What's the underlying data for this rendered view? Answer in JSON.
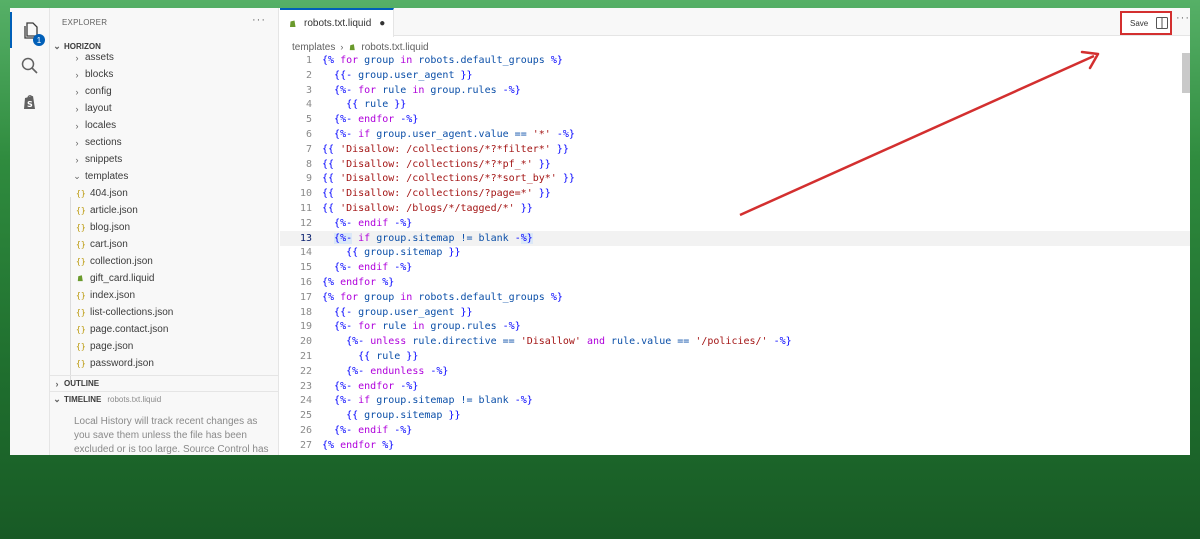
{
  "activity": {
    "explorer_badge": "1"
  },
  "sidebar": {
    "title": "EXPLORER",
    "more": "···",
    "project": "HORIZON",
    "folders": [
      "assets",
      "blocks",
      "config",
      "layout",
      "locales",
      "sections",
      "snippets"
    ],
    "templates_folder": "templates",
    "template_files": [
      {
        "name": "404.json",
        "icon": "{}"
      },
      {
        "name": "article.json",
        "icon": "{}"
      },
      {
        "name": "blog.json",
        "icon": "{}"
      },
      {
        "name": "cart.json",
        "icon": "{}"
      },
      {
        "name": "collection.json",
        "icon": "{}"
      },
      {
        "name": "gift_card.liquid",
        "icon": "shopify-icon"
      },
      {
        "name": "index.json",
        "icon": "{}"
      },
      {
        "name": "list-collections.json",
        "icon": "{}"
      },
      {
        "name": "page.contact.json",
        "icon": "{}"
      },
      {
        "name": "page.json",
        "icon": "{}"
      },
      {
        "name": "password.json",
        "icon": "{}"
      }
    ],
    "outline_label": "OUTLINE",
    "timeline_label": "TIMELINE",
    "timeline_file": "robots.txt.liquid",
    "timeline_text": "Local History will track recent changes as you save them unless the file has been excluded or is too large. Source Control has"
  },
  "editor": {
    "tab_label": "robots.txt.liquid",
    "tab_dirty": "●",
    "save_label": "Save",
    "more": "···",
    "breadcrumb": [
      "templates",
      "robots.txt.liquid"
    ],
    "current_line": 13
  },
  "code_lines": [
    [
      {
        "t": "{% ",
        "c": "kw-c"
      },
      {
        "t": "for",
        "c": "kw-m"
      },
      {
        "t": " group ",
        "c": "vr"
      },
      {
        "t": "in",
        "c": "kw-m"
      },
      {
        "t": " robots.default_groups ",
        "c": "vr"
      },
      {
        "t": "%}",
        "c": "kw-c"
      }
    ],
    [
      {
        "t": "  "
      },
      {
        "t": "{{- ",
        "c": "kw-c"
      },
      {
        "t": "group.user_agent",
        "c": "vr"
      },
      {
        "t": " }}",
        "c": "kw-c"
      }
    ],
    [
      {
        "t": "  "
      },
      {
        "t": "{%- ",
        "c": "kw-c"
      },
      {
        "t": "for",
        "c": "kw-m"
      },
      {
        "t": " rule ",
        "c": "vr"
      },
      {
        "t": "in",
        "c": "kw-m"
      },
      {
        "t": " group.rules ",
        "c": "vr"
      },
      {
        "t": "-%}",
        "c": "kw-c"
      }
    ],
    [
      {
        "t": "    "
      },
      {
        "t": "{{ ",
        "c": "kw-c"
      },
      {
        "t": "rule",
        "c": "vr"
      },
      {
        "t": " }}",
        "c": "kw-c"
      }
    ],
    [
      {
        "t": "  "
      },
      {
        "t": "{%- ",
        "c": "kw-c"
      },
      {
        "t": "endfor",
        "c": "kw-m"
      },
      {
        "t": " -%}",
        "c": "kw-c"
      }
    ],
    [
      {
        "t": "  "
      },
      {
        "t": "{%- ",
        "c": "kw-c"
      },
      {
        "t": "if",
        "c": "kw-m"
      },
      {
        "t": " group.user_agent.value == ",
        "c": "vr"
      },
      {
        "t": "'*'",
        "c": "st"
      },
      {
        "t": " -%}",
        "c": "kw-c"
      }
    ],
    [
      {
        "t": "{{ ",
        "c": "kw-c"
      },
      {
        "t": "'Disallow: /collections/*?*filter*'",
        "c": "st"
      },
      {
        "t": " }}",
        "c": "kw-c"
      }
    ],
    [
      {
        "t": "{{ ",
        "c": "kw-c"
      },
      {
        "t": "'Disallow: /collections/*?*pf_*'",
        "c": "st"
      },
      {
        "t": " }}",
        "c": "kw-c"
      }
    ],
    [
      {
        "t": "{{ ",
        "c": "kw-c"
      },
      {
        "t": "'Disallow: /collections/*?*sort_by*'",
        "c": "st"
      },
      {
        "t": " }}",
        "c": "kw-c"
      }
    ],
    [
      {
        "t": "{{ ",
        "c": "kw-c"
      },
      {
        "t": "'Disallow: /collections/?page=*'",
        "c": "st"
      },
      {
        "t": " }}",
        "c": "kw-c"
      }
    ],
    [
      {
        "t": "{{ ",
        "c": "kw-c"
      },
      {
        "t": "'Disallow: /blogs/*/tagged/*'",
        "c": "st"
      },
      {
        "t": " }}",
        "c": "kw-c"
      }
    ],
    [
      {
        "t": "  "
      },
      {
        "t": "{%- ",
        "c": "kw-c"
      },
      {
        "t": "endif",
        "c": "kw-m"
      },
      {
        "t": " -%}",
        "c": "kw-c"
      }
    ],
    [
      {
        "t": "  "
      },
      {
        "t": "{%-",
        "c": "kw-c hl"
      },
      {
        "t": " "
      },
      {
        "t": "if",
        "c": "kw-m"
      },
      {
        "t": " group.sitemap != blank ",
        "c": "vr"
      },
      {
        "t": "-",
        "c": "kw-c"
      },
      {
        "t": "%}",
        "c": "kw-c hl"
      }
    ],
    [
      {
        "t": "    "
      },
      {
        "t": "{{ ",
        "c": "kw-c"
      },
      {
        "t": "group.sitemap",
        "c": "vr"
      },
      {
        "t": " }}",
        "c": "kw-c"
      }
    ],
    [
      {
        "t": "  "
      },
      {
        "t": "{%- ",
        "c": "kw-c"
      },
      {
        "t": "endif",
        "c": "kw-m"
      },
      {
        "t": " -%}",
        "c": "kw-c"
      }
    ],
    [
      {
        "t": "{% ",
        "c": "kw-c"
      },
      {
        "t": "endfor",
        "c": "kw-m"
      },
      {
        "t": " %}",
        "c": "kw-c"
      }
    ],
    [
      {
        "t": "{% ",
        "c": "kw-c"
      },
      {
        "t": "for",
        "c": "kw-m"
      },
      {
        "t": " group ",
        "c": "vr"
      },
      {
        "t": "in",
        "c": "kw-m"
      },
      {
        "t": " robots.default_groups ",
        "c": "vr"
      },
      {
        "t": "%}",
        "c": "kw-c"
      }
    ],
    [
      {
        "t": "  "
      },
      {
        "t": "{{- ",
        "c": "kw-c"
      },
      {
        "t": "group.user_agent",
        "c": "vr"
      },
      {
        "t": " }}",
        "c": "kw-c"
      }
    ],
    [
      {
        "t": "  "
      },
      {
        "t": "{%- ",
        "c": "kw-c"
      },
      {
        "t": "for",
        "c": "kw-m"
      },
      {
        "t": " rule ",
        "c": "vr"
      },
      {
        "t": "in",
        "c": "kw-m"
      },
      {
        "t": " group.rules ",
        "c": "vr"
      },
      {
        "t": "-%}",
        "c": "kw-c"
      }
    ],
    [
      {
        "t": "    "
      },
      {
        "t": "{%- ",
        "c": "kw-c"
      },
      {
        "t": "unless",
        "c": "kw-m"
      },
      {
        "t": " rule.directive == ",
        "c": "vr"
      },
      {
        "t": "'Disallow'",
        "c": "st"
      },
      {
        "t": " and ",
        "c": "kw-m"
      },
      {
        "t": "rule.value == ",
        "c": "vr"
      },
      {
        "t": "'/policies/'",
        "c": "st"
      },
      {
        "t": " -%}",
        "c": "kw-c"
      }
    ],
    [
      {
        "t": "      "
      },
      {
        "t": "{{ ",
        "c": "kw-c"
      },
      {
        "t": "rule",
        "c": "vr"
      },
      {
        "t": " }}",
        "c": "kw-c"
      }
    ],
    [
      {
        "t": "    "
      },
      {
        "t": "{%- ",
        "c": "kw-c"
      },
      {
        "t": "endunless",
        "c": "kw-m"
      },
      {
        "t": " -%}",
        "c": "kw-c"
      }
    ],
    [
      {
        "t": "  "
      },
      {
        "t": "{%- ",
        "c": "kw-c"
      },
      {
        "t": "endfor",
        "c": "kw-m"
      },
      {
        "t": " -%}",
        "c": "kw-c"
      }
    ],
    [
      {
        "t": "  "
      },
      {
        "t": "{%- ",
        "c": "kw-c"
      },
      {
        "t": "if",
        "c": "kw-m"
      },
      {
        "t": " group.sitemap != blank ",
        "c": "vr"
      },
      {
        "t": "-%}",
        "c": "kw-c"
      }
    ],
    [
      {
        "t": "    "
      },
      {
        "t": "{{ ",
        "c": "kw-c"
      },
      {
        "t": "group.sitemap",
        "c": "vr"
      },
      {
        "t": " }}",
        "c": "kw-c"
      }
    ],
    [
      {
        "t": "  "
      },
      {
        "t": "{%- ",
        "c": "kw-c"
      },
      {
        "t": "endif",
        "c": "kw-m"
      },
      {
        "t": " -%}",
        "c": "kw-c"
      }
    ],
    [
      {
        "t": "{% ",
        "c": "kw-c"
      },
      {
        "t": "endfor",
        "c": "kw-m"
      },
      {
        "t": " %}",
        "c": "kw-c"
      }
    ]
  ],
  "colors": {
    "accent": "#005fb8",
    "annotation": "#d32f2f",
    "background": "#2f8b3e"
  }
}
